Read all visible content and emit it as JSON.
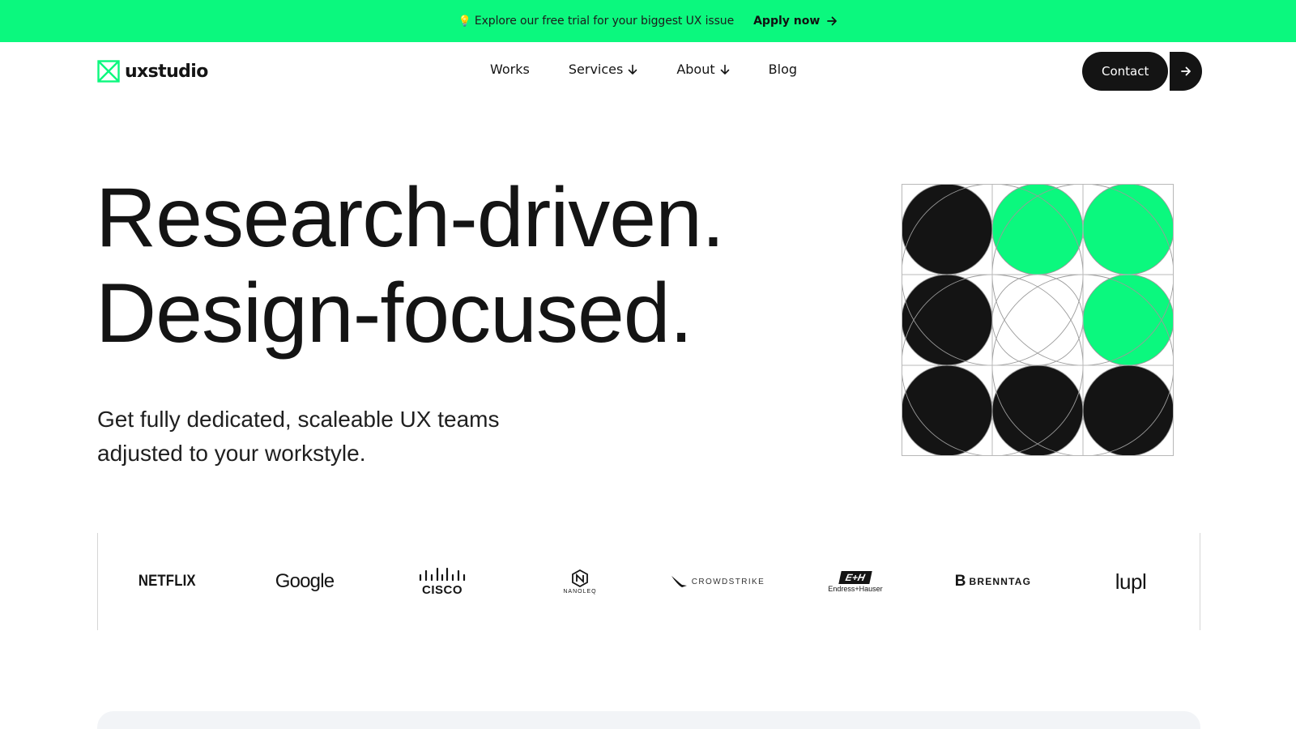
{
  "banner": {
    "icon": "lightbulb-icon",
    "emoji": "💡",
    "message": "Explore our free trial for your biggest UX issue",
    "cta": "Apply now",
    "background": "#0bf87e"
  },
  "header": {
    "brand": "uxstudio",
    "nav": {
      "works": "Works",
      "services": "Services",
      "about": "About",
      "blog": "Blog"
    },
    "contact": "Contact"
  },
  "hero": {
    "title_line1": "Research-driven.",
    "title_line2": "Design-focused.",
    "subtitle": "Get fully dedicated, scaleable UX teams adjusted to your workstyle."
  },
  "client_logos": {
    "netflix": "NETFLIX",
    "google": "Google",
    "cisco": "CISCO",
    "nanoleq": "NANOLEQ",
    "crowdstrike": "CROWDSTRIKE",
    "endress_mark": "E+H",
    "endress": "Endress+Hauser",
    "brenntag_mark": "B",
    "brenntag": "BRENNTAG",
    "lupl": "lupl"
  },
  "colors": {
    "accent": "#0bf87e",
    "dark": "#141414"
  }
}
